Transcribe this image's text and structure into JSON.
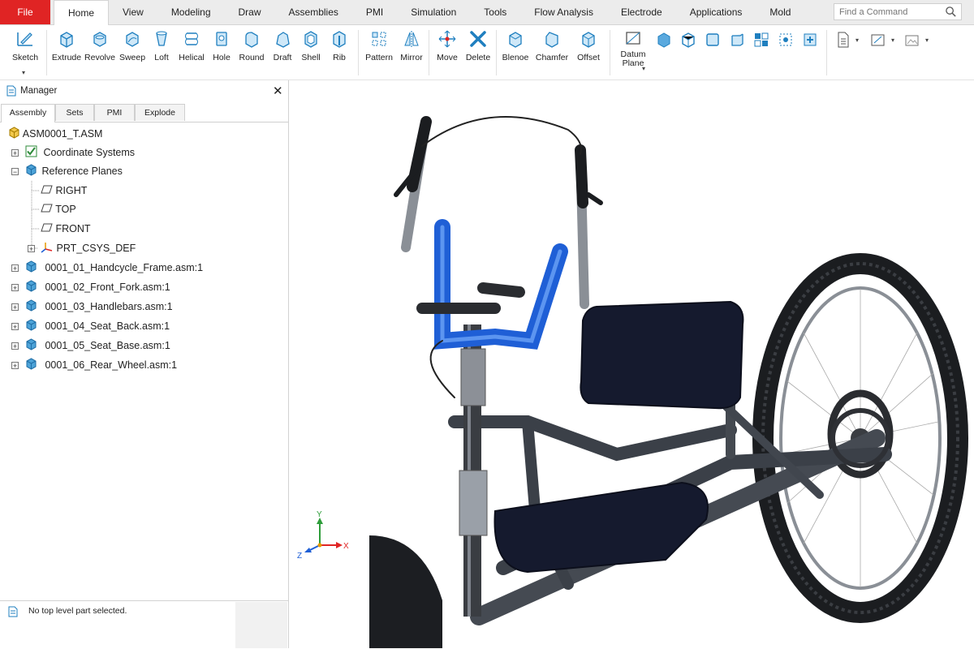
{
  "menubar": {
    "file_label": "File",
    "tabs": [
      "Home",
      "View",
      "Modeling",
      "Draw",
      "Assemblies",
      "PMI",
      "Simulation",
      "Tools",
      "Flow Analysis",
      "Electrode",
      "Applications",
      "Mold"
    ],
    "active_tab": "Home",
    "search_placeholder": "Find a Command"
  },
  "ribbon": {
    "tools": [
      "Sketch",
      "Extrude",
      "Revolve",
      "Sweep",
      "Loft",
      "Helical",
      "Hole",
      "Round",
      "Draft",
      "Shell",
      "Rib",
      "Pattern",
      "Mirror",
      "Move",
      "Delete",
      "Blenoe",
      "Chamfer",
      "Offset"
    ],
    "datum_plane": [
      "Datum",
      "Plane"
    ]
  },
  "manager": {
    "title": "Manager",
    "tabs": [
      "Assembly",
      "Sets",
      "PMI",
      "Explode"
    ],
    "active_tab": "Assembly",
    "tree": {
      "root": "ASM0001_T.ASM",
      "coordinate_systems": "Coordinate Systems",
      "reference_planes": "Reference Planes",
      "planes": [
        "RIGHT",
        "TOP",
        "FRONT"
      ],
      "csys": "PRT_CSYS_DEF",
      "assemblies": [
        "0001_01_Handcycle_Frame.asm:1",
        "0001_02_Front_Fork.asm:1",
        "0001_03_Handlebars.asm:1",
        "0001_04_Seat_Back.asm:1",
        "0001_05_Seat_Base.asm:1",
        "0001_06_Rear_Wheel.asm:1"
      ]
    },
    "status_text": "No top level part selected."
  },
  "viewport": {
    "axes": {
      "y": "Y",
      "x": "X",
      "z": "Z"
    }
  },
  "colors": {
    "accent": "#1f7fbf",
    "file_red": "#e02424",
    "selected_blue": "#1f5fd6"
  }
}
